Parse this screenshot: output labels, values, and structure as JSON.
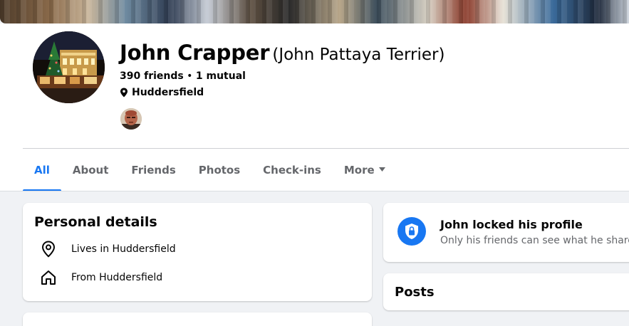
{
  "profile": {
    "name": "John Crapper",
    "alternate_name": "(John Pattaya Terrier)",
    "friends_count": "390 friends",
    "separator": " • ",
    "mutual": "1 mutual",
    "location": "Huddersfield"
  },
  "tabs": [
    {
      "label": "All",
      "active": true
    },
    {
      "label": "About"
    },
    {
      "label": "Friends"
    },
    {
      "label": "Photos"
    },
    {
      "label": "Check-ins"
    },
    {
      "label": "More"
    }
  ],
  "personal_details": {
    "title": "Personal details",
    "lives_in": "Lives in Huddersfield",
    "from": "From Huddersfield"
  },
  "locked_notice": {
    "title": "John locked his profile",
    "subtitle": "Only his friends can see what he shares o"
  },
  "posts": {
    "title": "Posts"
  },
  "icons": {
    "location": "map-pin-icon",
    "home": "home-icon",
    "lock": "shield-lock-icon",
    "caret": "caret-down-icon"
  },
  "colors": {
    "accent": "#1877f2",
    "secondary_text": "#65676b",
    "background": "#f0f2f5"
  }
}
